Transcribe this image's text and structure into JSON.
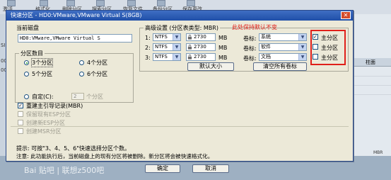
{
  "background": {
    "toolbar": [
      "激活",
      "格式化",
      "删除分区",
      "搜索分区",
      "恢复文件",
      "备份分区",
      "保存更改"
    ],
    "left_labels": [
      "SI",
      "00-",
      "00:"
    ],
    "right_header": "柱面",
    "bottom_right": "MBR",
    "watermark": "Bai 贴吧 | 联想z500吧"
  },
  "dialog": {
    "title": "快速分区 - HD0:VMware,VMware Virtual S(8GB)",
    "close_glyph": "✕",
    "current_disk_label": "当前磁盘",
    "current_disk_value": "HD0:VMware,VMware Virtual S",
    "partition_count": {
      "legend": "分区数目",
      "options": [
        {
          "label": "3个分区",
          "selected": true
        },
        {
          "label": "4个分区",
          "selected": false
        },
        {
          "label": "5个分区",
          "selected": false
        },
        {
          "label": "6个分区",
          "selected": false
        }
      ],
      "custom_label": "自定(C):",
      "custom_value": "2",
      "custom_suffix": "个分区"
    },
    "options": [
      {
        "label": "重建主引导记录(MBR)",
        "checked": true,
        "disabled": false
      },
      {
        "label": "保留现有ESP分区",
        "checked": false,
        "disabled": true
      },
      {
        "label": "创建新ESP分区",
        "checked": false,
        "disabled": true
      },
      {
        "label": "创建MSR分区",
        "checked": false,
        "disabled": true
      }
    ],
    "advanced": {
      "legend": "高级设置 (分区表类型: MBR)",
      "rows": [
        {
          "index": "1:",
          "fs": "NTFS",
          "size": "2730",
          "unit": "MB",
          "vol_label_title": "卷标:",
          "vol_label": "系统",
          "primary_label": "主分区",
          "primary_checked": true
        },
        {
          "index": "2:",
          "fs": "NTFS",
          "size": "2730",
          "unit": "MB",
          "vol_label_title": "卷标:",
          "vol_label": "软件",
          "primary_label": "主分区",
          "primary_checked": false
        },
        {
          "index": "3:",
          "fs": "NTFS",
          "size": "2730",
          "unit": "MB",
          "vol_label_title": "卷标:",
          "vol_label": "文档",
          "primary_label": "主分区",
          "primary_checked": false
        }
      ],
      "default_size_button": "默认大小",
      "clear_labels_button": "清空所有卷标"
    },
    "annotation": "此处保持默认不变",
    "hint_line1": "提示: 可按\"3、4、5、6\"快速选择分区个数。",
    "hint_line2": "注意: 此功能执行后，当前磁盘上的现有分区将被删除。新分区将会被快速格式化。",
    "ok_button": "确定",
    "cancel_button": "取消",
    "colors": {
      "title_bar": "#1f4fa8",
      "annotation": "#e0201a",
      "dialog_bg": "#ece9d8"
    }
  }
}
